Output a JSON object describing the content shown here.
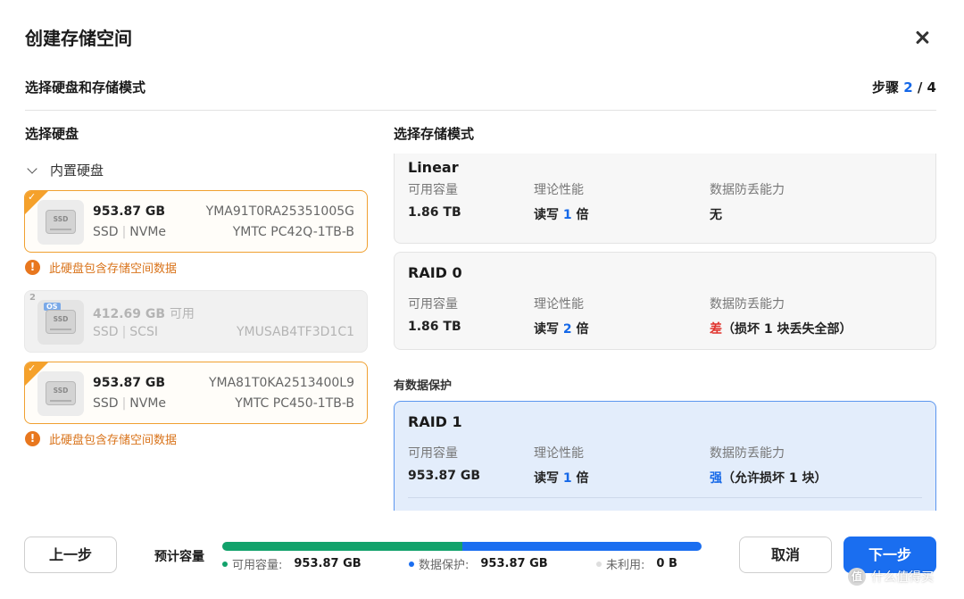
{
  "dialog": {
    "title": "创建存储空间",
    "subtitle": "选择硬盘和存储模式",
    "step_label": "步骤",
    "step_current": "2",
    "step_total": "/ 4"
  },
  "left": {
    "section_title": "选择硬盘",
    "group_label": "内置硬盘",
    "disks": [
      {
        "selected": true,
        "disabled": false,
        "capacity": "953.87 GB",
        "available_label": "",
        "media": "SSD",
        "interface": "NVMe",
        "serial": "YMA91T0RA25351005G",
        "model": "YMTC PC42Q-1TB-B",
        "os_badge": "",
        "index": "",
        "warning": "此硬盘包含存储空间数据"
      },
      {
        "selected": false,
        "disabled": true,
        "capacity": "412.69 GB",
        "available_label": "可用",
        "media": "SSD",
        "interface": "SCSI",
        "serial": "",
        "model": "YMUSAB4TF3D1C1",
        "os_badge": "OS",
        "index": "2",
        "warning": ""
      },
      {
        "selected": true,
        "disabled": false,
        "capacity": "953.87 GB",
        "available_label": "",
        "media": "SSD",
        "interface": "NVMe",
        "serial": "YMA81T0KA2513400L9",
        "model": "YMTC PC450-1TB-B",
        "os_badge": "",
        "index": "",
        "warning": "此硬盘包含存储空间数据"
      }
    ],
    "check_glyph": "✓",
    "drive_text": "SSD",
    "warning_glyph": "!"
  },
  "right": {
    "section_title": "选择存储模式",
    "col_capacity": "可用容量",
    "col_performance": "理论性能",
    "col_protection": "数据防丢能力",
    "protected_group_title": "有数据保护",
    "modes": [
      {
        "name": "Linear",
        "capacity": "1.86 TB",
        "perf_prefix": "读写",
        "perf_num": "1",
        "perf_suffix": "倍",
        "protection_strong": "无",
        "protection_rest": "",
        "protection_color": "#222222",
        "selected": false
      },
      {
        "name": "RAID 0",
        "capacity": "1.86 TB",
        "perf_prefix": "读写",
        "perf_num": "2",
        "perf_suffix": "倍",
        "protection_strong": "差",
        "protection_rest": "（损坏 1 块丢失全部）",
        "protection_color": "#e0322c",
        "selected": false
      },
      {
        "name": "RAID 1",
        "capacity": "953.87 GB",
        "perf_prefix": "读写",
        "perf_num": "1",
        "perf_suffix": "倍",
        "protection_strong": "强",
        "protection_rest": "（允许损坏 1 块）",
        "protection_color": "#1568e8",
        "selected": true
      }
    ]
  },
  "footer": {
    "prev_label": "上一步",
    "estimate_label": "预计容量",
    "cancel_label": "取消",
    "next_label": "下一步",
    "usage": [
      {
        "label": "可用容量:",
        "value": "953.87 GB",
        "color": "#12a26b",
        "fraction": 0.5
      },
      {
        "label": "数据保护:",
        "value": "953.87 GB",
        "color": "#1a6ef0",
        "fraction": 0.5
      },
      {
        "label": "未利用:",
        "value": "0 B",
        "color": "#dedede",
        "fraction": 0.0
      }
    ]
  },
  "watermark": {
    "logo_glyph": "值",
    "text": "什么值得买"
  }
}
